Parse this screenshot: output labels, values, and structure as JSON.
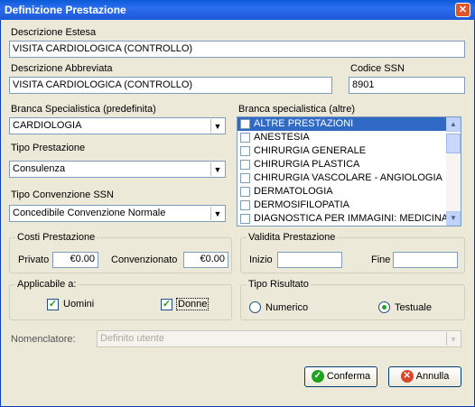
{
  "window": {
    "title": "Definizione Prestazione"
  },
  "descrizione_estesa": {
    "label": "Descrizione Estesa",
    "value": "VISITA CARDIOLOGICA (CONTROLLO)"
  },
  "descrizione_abbreviata": {
    "label": "Descrizione Abbreviata",
    "value": "VISITA CARDIOLOGICA (CONTROLLO)"
  },
  "codice_ssn": {
    "label": "Codice SSN",
    "value": "8901"
  },
  "branca_predefinita": {
    "label": "Branca Specialistica (predefinita)",
    "value": "CARDIOLOGIA"
  },
  "tipo_prestazione": {
    "label": "Tipo Prestazione",
    "value": "Consulenza"
  },
  "tipo_convenzione": {
    "label": "Tipo Convenzione SSN",
    "value": "Concedibile Convenzione Normale"
  },
  "branca_altre": {
    "label": "Branca specialistica (altre)",
    "items": [
      "ALTRE PRESTAZIONI",
      "ANESTESIA",
      "CHIRURGIA GENERALE",
      "CHIRURGIA PLASTICA",
      "CHIRURGIA VASCOLARE - ANGIOLOGIA",
      "DERMATOLOGIA",
      "DERMOSIFILOPATIA",
      "DIAGNOSTICA PER IMMAGINI: MEDICINA"
    ]
  },
  "costi": {
    "legend": "Costi Prestazione",
    "privato_label": "Privato",
    "privato_value": "€0.00",
    "convenzionato_label": "Convenzionato",
    "convenzionato_value": "€0.00"
  },
  "validita": {
    "legend": "Validita Prestazione",
    "inizio_label": "Inizio",
    "fine_label": "Fine"
  },
  "applicabile": {
    "legend": "Applicabile a:",
    "uomini_label": "Uomini",
    "donne_label": "Donne"
  },
  "tipo_risultato": {
    "legend": "Tipo Risultato",
    "numerico_label": "Numerico",
    "testuale_label": "Testuale"
  },
  "nomenclatore": {
    "label": "Nomenclatore:",
    "value": "Definito utente"
  },
  "buttons": {
    "conferma": "Conferma",
    "annulla": "Annulla"
  },
  "colors": {
    "title_bar": "#0a5ad8",
    "selection": "#316ac5",
    "confirm_icon": "#21a121",
    "cancel_icon": "#d9462a"
  }
}
